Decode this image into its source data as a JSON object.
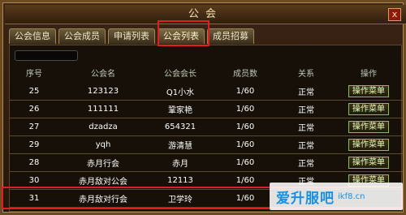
{
  "window": {
    "title": "公会",
    "close": "x"
  },
  "tabs": [
    "公会信息",
    "公会成员",
    "申请列表",
    "公会列表",
    "成员招募"
  ],
  "table": {
    "headers": [
      "序号",
      "公会名",
      "公会会长",
      "成员数",
      "关系",
      "操作"
    ],
    "rows": [
      {
        "idx": "25",
        "name": "123123",
        "leader": "Q1小水",
        "members": "1/60",
        "status": "正常",
        "op": "操作菜单"
      },
      {
        "idx": "26",
        "name": "111111",
        "leader": "鞏家艳",
        "members": "1/60",
        "status": "正常",
        "op": "操作菜单"
      },
      {
        "idx": "27",
        "name": "dzadza",
        "leader": "654321",
        "members": "1/60",
        "status": "正常",
        "op": "操作菜单"
      },
      {
        "idx": "29",
        "name": "yqh",
        "leader": "游清慧",
        "members": "1/60",
        "status": "正常",
        "op": "操作菜单"
      },
      {
        "idx": "28",
        "name": "赤月行会",
        "leader": "赤月",
        "members": "1/60",
        "status": "正常",
        "op": "操作菜单"
      },
      {
        "idx": "30",
        "name": "赤月敌对公会",
        "leader": "12113",
        "members": "1/60",
        "status": "正常",
        "op": "操作菜单"
      },
      {
        "idx": "31",
        "name": "赤月敌对行会",
        "leader": "卫学玲",
        "members": "1/60",
        "status": "",
        "op": ""
      }
    ]
  },
  "watermark": {
    "logo": "爱升服吧",
    "url": "ikf8.cn"
  }
}
